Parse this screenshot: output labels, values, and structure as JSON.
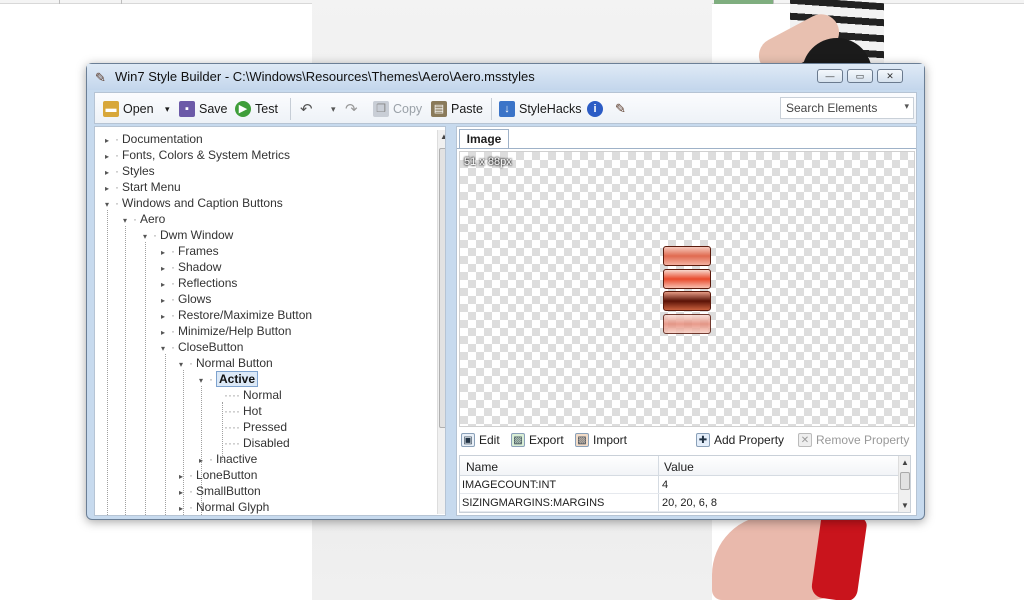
{
  "window": {
    "title": "Win7 Style Builder - C:\\Windows\\Resources\\Themes\\Aero\\Aero.msstyles",
    "controls": {
      "minimize": "—",
      "maximize": "▭",
      "close": "✕"
    }
  },
  "toolbar": {
    "open": "Open",
    "save": "Save",
    "test": "Test",
    "copy": "Copy",
    "paste": "Paste",
    "stylehacks": "StyleHacks",
    "search_placeholder": "Search Elements"
  },
  "tree": {
    "nodes": [
      {
        "label": "Documentation",
        "expander": "▸"
      },
      {
        "label": "Fonts, Colors & System Metrics",
        "expander": "▸"
      },
      {
        "label": "Styles",
        "expander": "▸"
      },
      {
        "label": "Start Menu",
        "expander": "▸"
      },
      {
        "label": "Windows and Caption Buttons",
        "expander": "▾"
      },
      {
        "label": "Aero",
        "expander": "▾"
      },
      {
        "label": "Dwm Window",
        "expander": "▾"
      },
      {
        "label": "Frames",
        "expander": "▸"
      },
      {
        "label": "Shadow",
        "expander": "▸"
      },
      {
        "label": "Reflections",
        "expander": "▸"
      },
      {
        "label": "Glows",
        "expander": "▸"
      },
      {
        "label": "Restore/Maximize Button",
        "expander": "▸"
      },
      {
        "label": "Minimize/Help Button",
        "expander": "▸"
      },
      {
        "label": "CloseButton",
        "expander": "▾"
      },
      {
        "label": "Normal Button",
        "expander": "▾"
      },
      {
        "label": "Active",
        "expander": "▾"
      },
      {
        "label": "Normal",
        "expander": ""
      },
      {
        "label": "Hot",
        "expander": ""
      },
      {
        "label": "Pressed",
        "expander": ""
      },
      {
        "label": "Disabled",
        "expander": ""
      },
      {
        "label": "Inactive",
        "expander": "▸"
      },
      {
        "label": "LoneButton",
        "expander": "▸"
      },
      {
        "label": "SmallButton",
        "expander": "▸"
      },
      {
        "label": "Normal Glyph",
        "expander": "▸"
      }
    ]
  },
  "preview": {
    "tab": "Image",
    "dimensions": "51 x 88px"
  },
  "actions": {
    "edit": "Edit",
    "export": "Export",
    "import": "Import",
    "add_property": "Add Property",
    "remove_property": "Remove Property"
  },
  "properties": {
    "columns": [
      "Name",
      "Value"
    ],
    "rows": [
      {
        "name": "IMAGECOUNT:INT",
        "value": "4"
      },
      {
        "name": "SIZINGMARGINS:MARGINS",
        "value": "20, 20, 6, 8"
      }
    ]
  }
}
